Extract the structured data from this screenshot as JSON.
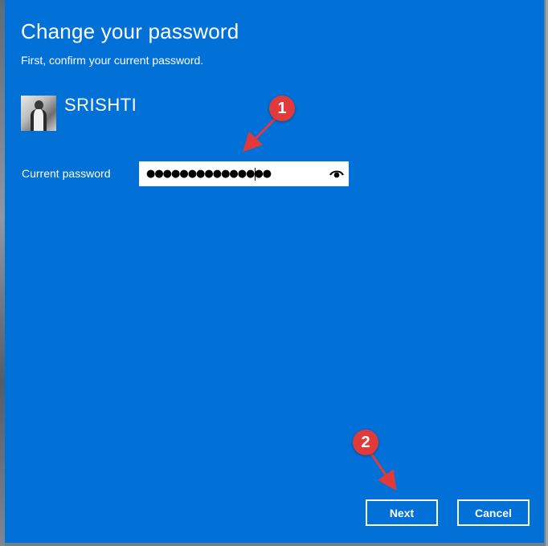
{
  "dialog": {
    "title": "Change your password",
    "subtitle": "First, confirm your current password."
  },
  "user": {
    "name": "SRISHTI",
    "avatar_icon": "user-avatar"
  },
  "password": {
    "label": "Current password",
    "value_masked": "●●●●●●●●●●●●●●●",
    "reveal_icon": "eye-icon"
  },
  "annotations": {
    "step1": "1",
    "step2": "2",
    "marker_color": "#e23a3a"
  },
  "buttons": {
    "next_label": "Next",
    "cancel_label": "Cancel"
  },
  "colors": {
    "dialog_bg": "#0171d8",
    "text": "#ffffff"
  }
}
